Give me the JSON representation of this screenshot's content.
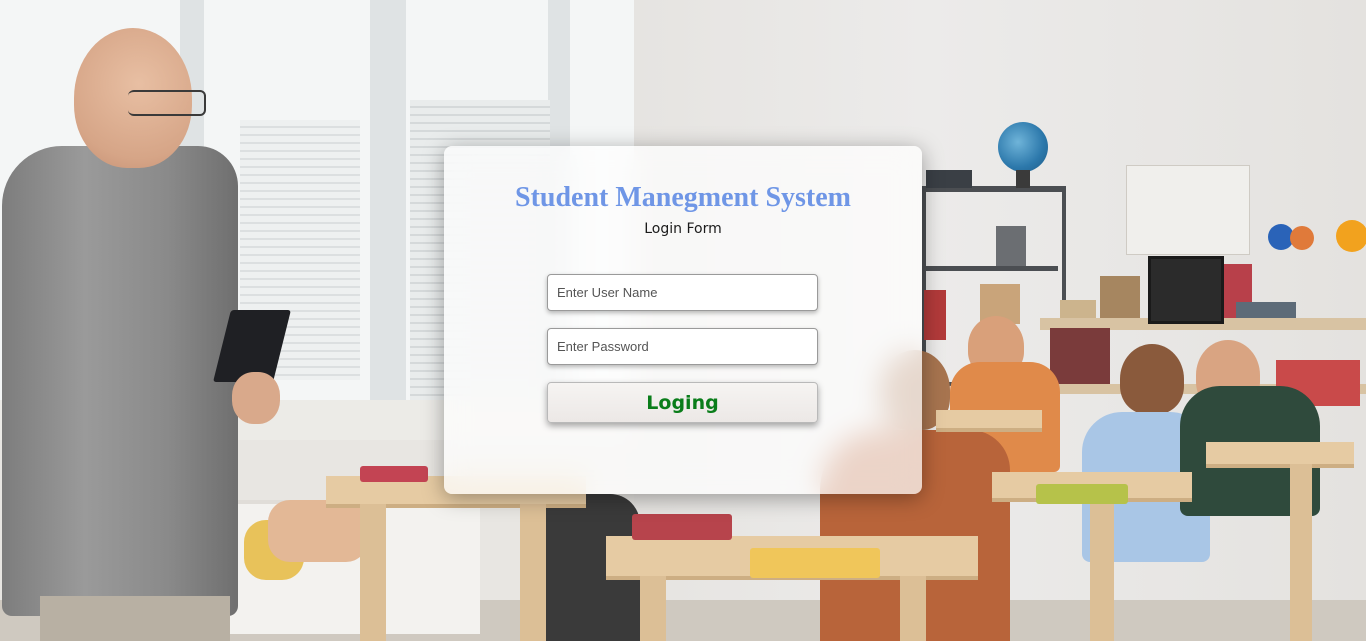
{
  "login": {
    "title": "Student Manegment System",
    "subtitle": "Login Form",
    "username_placeholder": "Enter User Name",
    "password_placeholder": "Enter Password",
    "submit_label": "Loging"
  },
  "colors": {
    "title": "#6f96e6",
    "button_text": "#0a7d1a",
    "card_background": "#ffffff"
  }
}
